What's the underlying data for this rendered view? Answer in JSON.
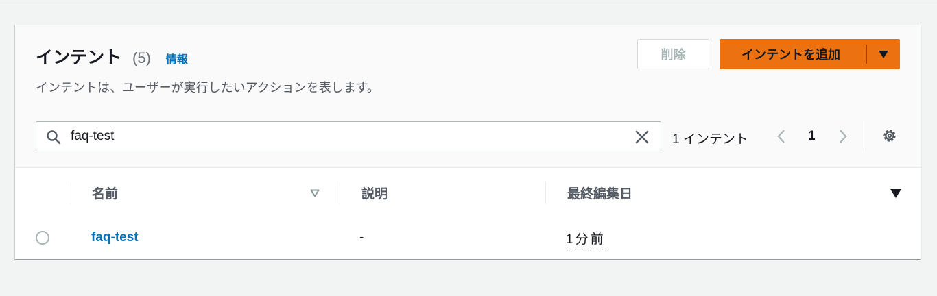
{
  "colors": {
    "accent": "#0073bb",
    "primary_button": "#ec7211",
    "text": "#16191f",
    "muted": "#687078"
  },
  "header": {
    "title": "インテント",
    "count": "(5)",
    "info_link": "情報",
    "description": "インテントは、ユーザーが実行したいアクションを表します。",
    "delete_button": "削除",
    "add_button": "インテントを追加"
  },
  "filter": {
    "search_value": "faq-test",
    "result_count": "1 インテント",
    "page": "1",
    "icons": [
      "search-icon",
      "clear-icon",
      "chevron-left-icon",
      "chevron-right-icon",
      "gear-icon"
    ]
  },
  "table": {
    "columns": [
      "名前",
      "説明",
      "最終編集日"
    ],
    "rows": [
      {
        "name": "faq-test",
        "description": "-",
        "last_edited": "1分前"
      }
    ]
  }
}
